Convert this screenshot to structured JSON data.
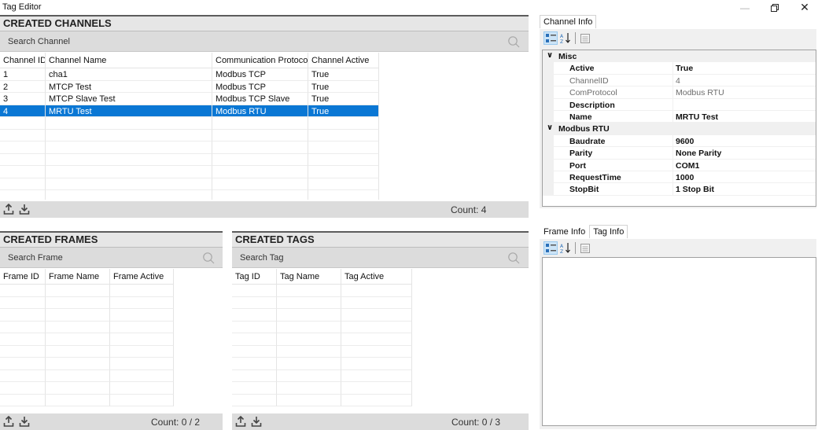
{
  "window": {
    "title": "Tag Editor"
  },
  "channels": {
    "header": "CREATED CHANNELS",
    "search_placeholder": "Search Channel",
    "columns": [
      "Channel ID",
      "Channel Name",
      "Communication Protocol",
      "Channel Active"
    ],
    "rows": [
      [
        "1",
        "cha1",
        "Modbus TCP",
        "True"
      ],
      [
        "2",
        "MTCP Test",
        "Modbus TCP",
        "True"
      ],
      [
        "3",
        "MTCP Slave Test",
        "Modbus TCP Slave",
        "True"
      ],
      [
        "4",
        "MRTU Test",
        "Modbus RTU",
        "True"
      ]
    ],
    "selected_row": 4,
    "count": "Count: 4"
  },
  "frames": {
    "header": "CREATED FRAMES",
    "search_placeholder": "Search Frame",
    "columns": [
      "Frame ID",
      "Frame Name",
      "Frame Active"
    ],
    "count": "Count: 0 / 2"
  },
  "tags": {
    "header": "CREATED TAGS",
    "search_placeholder": "Search Tag",
    "columns": [
      "Tag ID",
      "Tag Name",
      "Tag Active"
    ],
    "count": "Count: 0 / 3"
  },
  "channel_info": {
    "tab": "Channel Info",
    "categories": [
      {
        "name": "Misc",
        "props": [
          {
            "name": "Active",
            "value": "True",
            "readonly": false
          },
          {
            "name": "ChannelID",
            "value": "4",
            "readonly": true
          },
          {
            "name": "ComProtocol",
            "value": "Modbus RTU",
            "readonly": true
          },
          {
            "name": "Description",
            "value": "",
            "readonly": false
          },
          {
            "name": "Name",
            "value": "MRTU Test",
            "readonly": false
          }
        ]
      },
      {
        "name": "Modbus RTU",
        "props": [
          {
            "name": "Baudrate",
            "value": "9600",
            "readonly": false
          },
          {
            "name": "Parity",
            "value": "None Parity",
            "readonly": false
          },
          {
            "name": "Port",
            "value": "COM1",
            "readonly": false
          },
          {
            "name": "RequestTime",
            "value": "1000",
            "readonly": false
          },
          {
            "name": "StopBit",
            "value": "1 Stop Bit",
            "readonly": false
          }
        ]
      }
    ]
  },
  "info_tabs": {
    "frame": "Frame Info",
    "tag": "Tag Info"
  },
  "icons": {
    "categorized": "categorized-icon",
    "alphabetical": "sort-alphabetical-icon",
    "property_pages": "property-pages-icon",
    "export": "upload-icon",
    "import": "download-icon",
    "search": "search-icon"
  },
  "colors": {
    "selection": "#0a77d4",
    "header_bg": "#e6e6e6",
    "bar_bg": "#dcdcdc"
  }
}
